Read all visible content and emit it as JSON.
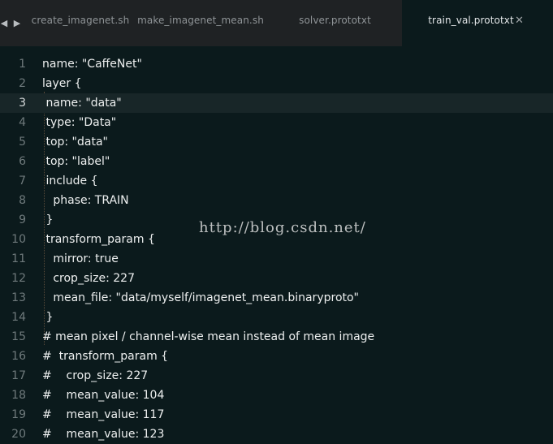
{
  "tabs": [
    {
      "label": "create_imagenet.sh",
      "active": false
    },
    {
      "label": "make_imagenet_mean.sh",
      "active": false
    },
    {
      "label": "solver.prototxt",
      "active": false
    },
    {
      "label": "train_val.prototxt",
      "active": true
    }
  ],
  "icons": {
    "back": "triangle-left-icon",
    "forward": "triangle-right-icon",
    "close": "close-icon"
  },
  "glyphs": {
    "back": "◀",
    "forward": "▶",
    "close": "✕"
  },
  "editor": {
    "current_line": 3,
    "lines": [
      {
        "n": "1",
        "text": "name: \"CaffeNet\""
      },
      {
        "n": "2",
        "text": "layer {"
      },
      {
        "n": "3",
        "text": " name: \"data\""
      },
      {
        "n": "4",
        "text": " type: \"Data\""
      },
      {
        "n": "5",
        "text": " top: \"data\""
      },
      {
        "n": "6",
        "text": " top: \"label\""
      },
      {
        "n": "7",
        "text": " include {"
      },
      {
        "n": "8",
        "text": "   phase: TRAIN"
      },
      {
        "n": "9",
        "text": " }"
      },
      {
        "n": "10",
        "text": " transform_param {"
      },
      {
        "n": "11",
        "text": "   mirror: true"
      },
      {
        "n": "12",
        "text": "   crop_size: 227"
      },
      {
        "n": "13",
        "text": "   mean_file: \"data/myself/imagenet_mean.binaryproto\""
      },
      {
        "n": "14",
        "text": " }"
      },
      {
        "n": "15",
        "text": "# mean pixel / channel-wise mean instead of mean image"
      },
      {
        "n": "16",
        "text": "#  transform_param {"
      },
      {
        "n": "17",
        "text": "#    crop_size: 227"
      },
      {
        "n": "18",
        "text": "#    mean_value: 104"
      },
      {
        "n": "19",
        "text": "#    mean_value: 117"
      },
      {
        "n": "20",
        "text": "#    mean_value: 123"
      }
    ]
  },
  "watermark": "http://blog.csdn.net/",
  "colors": {
    "background": "#0b1a1c",
    "tabbar": "#1f2224",
    "text": "#eef0f0",
    "line_number": "#6f7a7c",
    "current_line": "#182628"
  }
}
